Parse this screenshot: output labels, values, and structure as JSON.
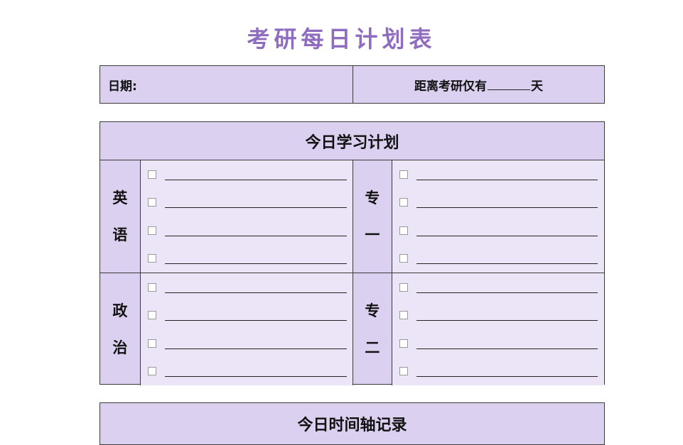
{
  "title": "考研每日计划表",
  "header": {
    "date_label": "日期:",
    "countdown_prefix": "距离考研仅有",
    "countdown_suffix": "天"
  },
  "plan": {
    "title": "今日学习计划",
    "rows": [
      {
        "left_subject": [
          "英",
          "语"
        ],
        "right_subject": [
          "专",
          "一"
        ]
      },
      {
        "left_subject": [
          "政",
          "治"
        ],
        "right_subject": [
          "专",
          "二"
        ]
      }
    ]
  },
  "timeline": {
    "title": "今日时间轴记录"
  },
  "colors": {
    "accent": "#8e6cc0",
    "header_fill": "#dcd0f0",
    "cell_fill": "#ece5f7"
  }
}
